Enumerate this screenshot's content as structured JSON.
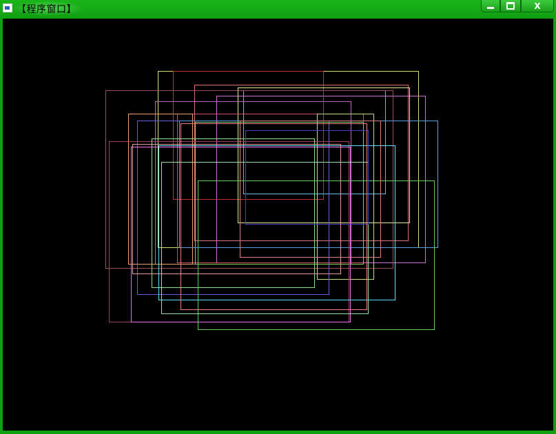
{
  "window": {
    "title": "【程序窗口】",
    "buttons": {
      "close_label": "X"
    }
  },
  "canvas": {
    "background": "#000000",
    "rectangles": [
      {
        "color": "#d8e07a"
      },
      {
        "color": "#c03030"
      },
      {
        "color": "#e07070"
      },
      {
        "color": "#d070d0"
      },
      {
        "color": "#60c0e0"
      },
      {
        "color": "#a05050"
      },
      {
        "color": "#e8e890"
      },
      {
        "color": "#c060c0"
      },
      {
        "color": "#d05060"
      },
      {
        "color": "#f0a070"
      },
      {
        "color": "#c0e080"
      },
      {
        "color": "#6060e0"
      },
      {
        "color": "#80d060"
      },
      {
        "color": "#60a0e0"
      },
      {
        "color": "#a04060"
      },
      {
        "color": "#f070f0"
      },
      {
        "color": "#90e090"
      },
      {
        "color": "#60d060"
      },
      {
        "color": "#a0e0a0"
      },
      {
        "color": "#60e0ff"
      },
      {
        "color": "#e08080"
      },
      {
        "color": "#4040c0"
      },
      {
        "color": "#f08080"
      },
      {
        "color": "#e0a0a0"
      }
    ]
  }
}
